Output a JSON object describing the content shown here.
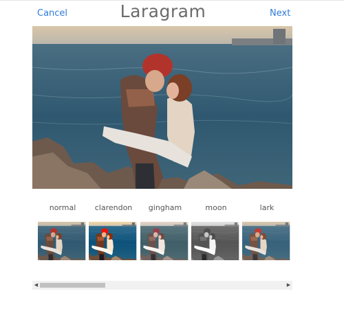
{
  "header": {
    "cancel_label": "Cancel",
    "title": "Laragram",
    "next_label": "Next"
  },
  "filters": [
    {
      "name": "normal"
    },
    {
      "name": "clarendon"
    },
    {
      "name": "gingham"
    },
    {
      "name": "moon"
    },
    {
      "name": "lark"
    }
  ],
  "colors": {
    "link": "#2e7bd8",
    "title": "#6b6b6b",
    "scrollbar_track": "#f1f1f1",
    "scrollbar_thumb": "#c1c1c1"
  },
  "scrollbar": {
    "left_arrow_icon": "chevron-left-icon",
    "right_arrow_icon": "chevron-right-icon"
  }
}
